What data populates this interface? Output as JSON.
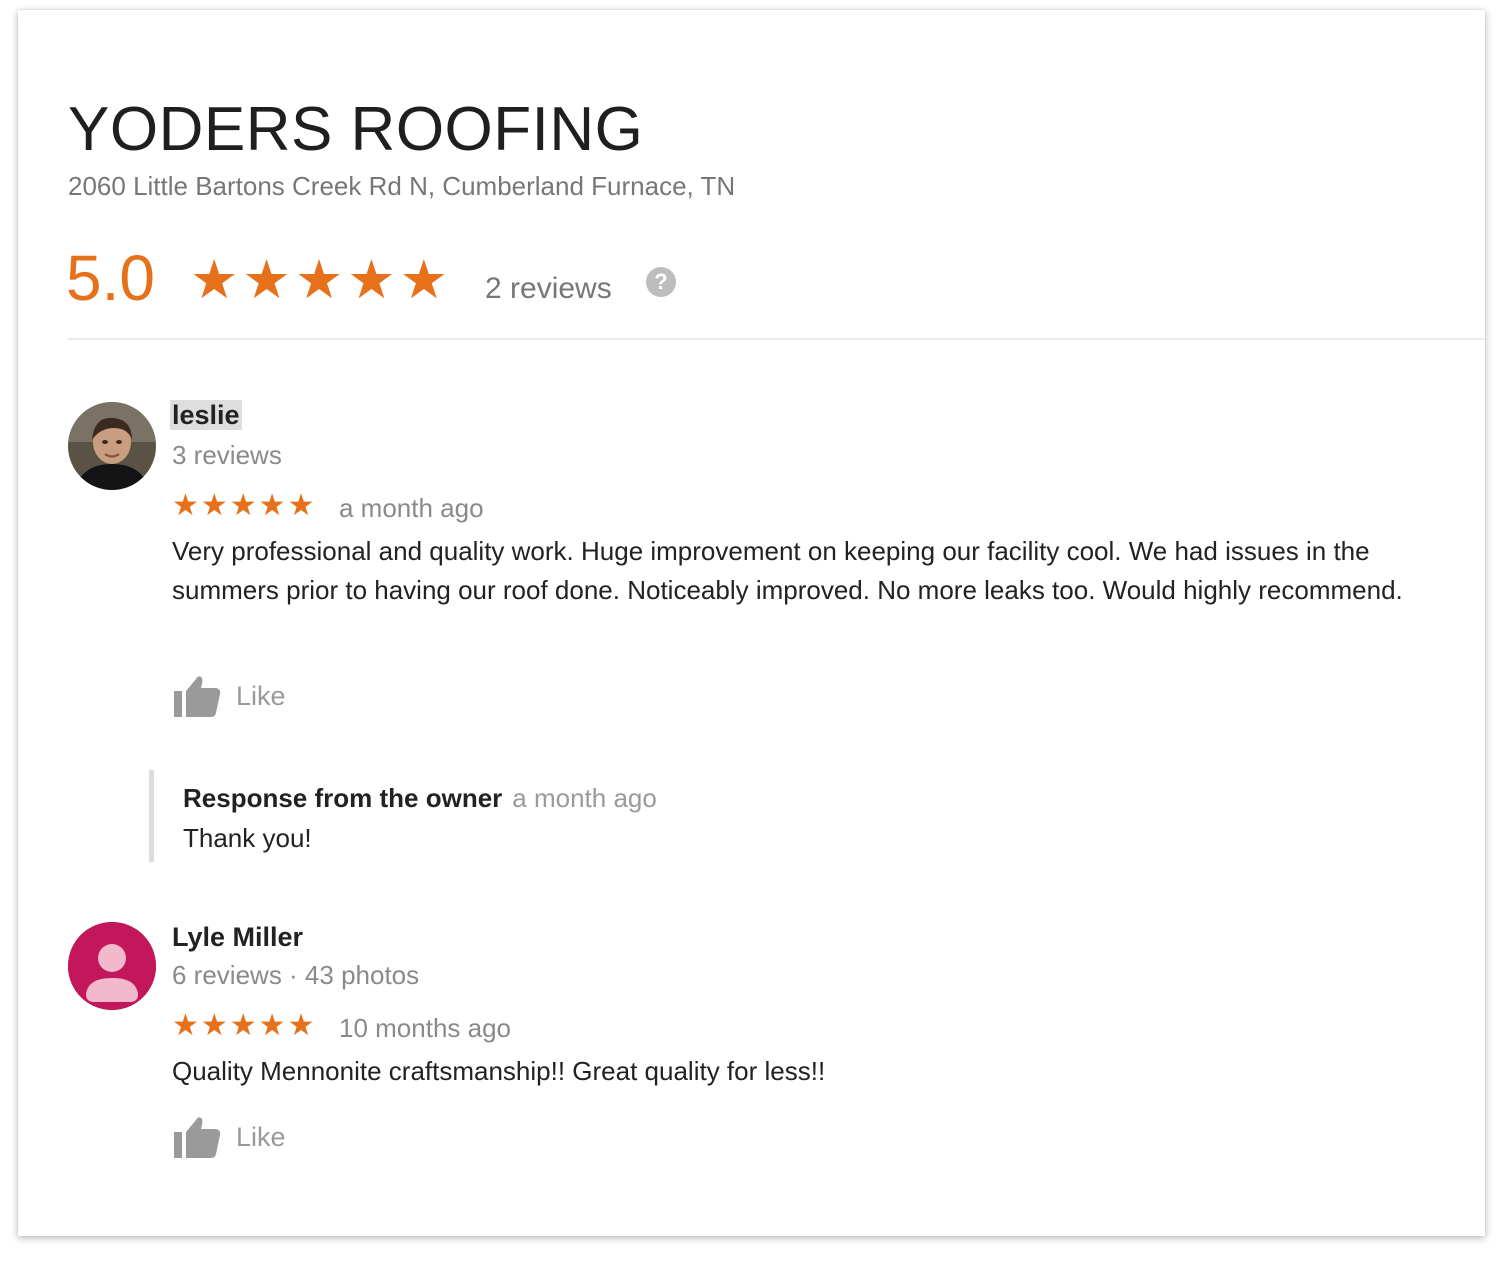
{
  "business": {
    "name": "YODERS ROOFING",
    "address": "2060 Little Bartons Creek Rd N, Cumberland Furnace, TN",
    "rating": "5.0",
    "stars": "★★★★★",
    "review_count": "2 reviews",
    "help_icon": "?"
  },
  "colors": {
    "accent": "#e7711b",
    "secondary_text": "#777777",
    "avatar_pink": "#c2185b"
  },
  "reviews": [
    {
      "name": "leslie",
      "meta": "3 reviews",
      "stars": "★★★★★",
      "rating": 5,
      "time": "a month ago",
      "text": "Very professional and quality work.  Huge improvement on keeping our facility cool.  We had issues in the summers prior to having our roof done.  Noticeably improved.  No more leaks too.  Would highly recommend.",
      "like_label": "Like",
      "owner_response": {
        "label": "Response from the owner",
        "time": "a month ago",
        "text": "Thank you!"
      }
    },
    {
      "name": "Lyle Miller",
      "meta": "6 reviews · 43 photos",
      "stars": "★★★★★",
      "rating": 5,
      "time": "10 months ago",
      "text": "Quality Mennonite craftsmanship!! Great quality for less!!",
      "like_label": "Like"
    }
  ],
  "icons": [
    "help-icon",
    "thumbs-up-icon",
    "avatar-photo",
    "default-person-icon"
  ]
}
